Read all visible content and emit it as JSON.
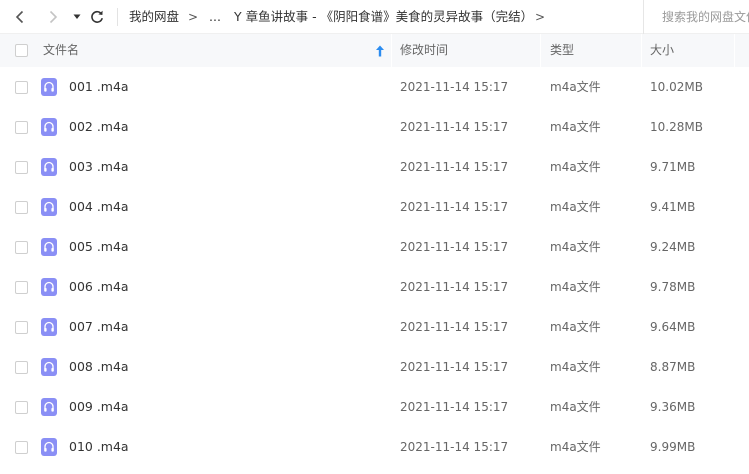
{
  "nav": {
    "back_label": "后退",
    "forward_label": "前进",
    "history_label": "历史",
    "refresh_label": "刷新"
  },
  "breadcrumb": {
    "root": "我的网盘",
    "sep": ">",
    "ellipsis": "...",
    "current": "Y 章鱼讲故事 - 《阴阳食谱》美食的灵异故事（完结）",
    "tail_sep": ">"
  },
  "search": {
    "placeholder": "搜索我的网盘文件"
  },
  "table": {
    "columns": {
      "name": "文件名",
      "modified": "修改时间",
      "type": "类型",
      "size": "大小"
    },
    "sort": {
      "column": "name",
      "direction": "asc"
    },
    "rows": [
      {
        "name": "001 .m4a",
        "modified": "2021-11-14 15:17",
        "type": "m4a文件",
        "size": "10.02MB"
      },
      {
        "name": "002 .m4a",
        "modified": "2021-11-14 15:17",
        "type": "m4a文件",
        "size": "10.28MB"
      },
      {
        "name": "003 .m4a",
        "modified": "2021-11-14 15:17",
        "type": "m4a文件",
        "size": "9.71MB"
      },
      {
        "name": "004 .m4a",
        "modified": "2021-11-14 15:17",
        "type": "m4a文件",
        "size": "9.41MB"
      },
      {
        "name": "005 .m4a",
        "modified": "2021-11-14 15:17",
        "type": "m4a文件",
        "size": "9.24MB"
      },
      {
        "name": "006 .m4a",
        "modified": "2021-11-14 15:17",
        "type": "m4a文件",
        "size": "9.78MB"
      },
      {
        "name": "007 .m4a",
        "modified": "2021-11-14 15:17",
        "type": "m4a文件",
        "size": "9.64MB"
      },
      {
        "name": "008 .m4a",
        "modified": "2021-11-14 15:17",
        "type": "m4a文件",
        "size": "8.87MB"
      },
      {
        "name": "009 .m4a",
        "modified": "2021-11-14 15:17",
        "type": "m4a文件",
        "size": "9.36MB"
      },
      {
        "name": "010 .m4a",
        "modified": "2021-11-14 15:17",
        "type": "m4a文件",
        "size": "9.99MB"
      }
    ]
  },
  "icons": {
    "file": "headphones-icon"
  },
  "colors": {
    "file_icon": "#8a8ff5",
    "sort_arrow": "#2b8cf0",
    "header_bg": "#f7f8fa"
  }
}
